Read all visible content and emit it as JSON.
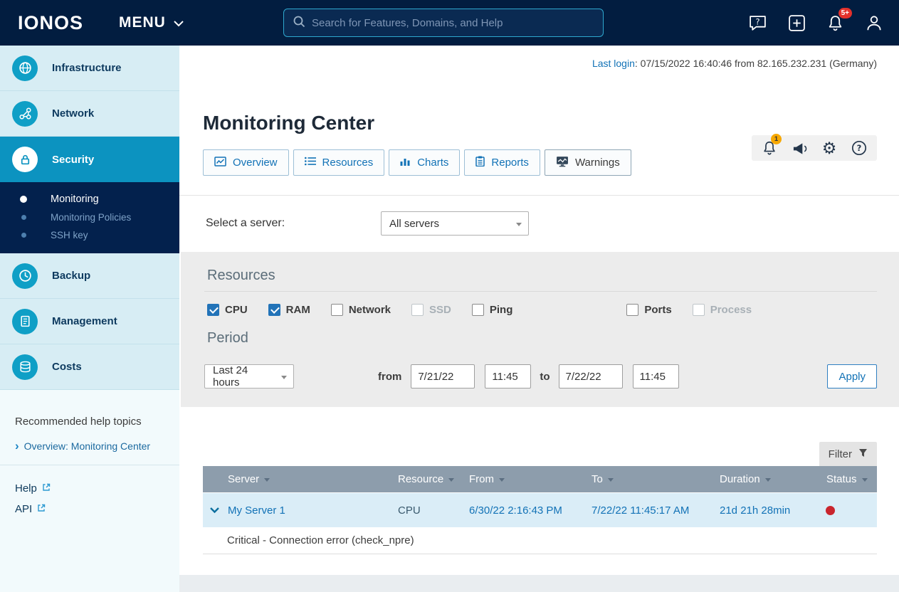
{
  "topbar": {
    "logo": "IONOS",
    "menu_label": "MENU",
    "search_placeholder": "Search for Features, Domains, and Help",
    "notifications_badge": "5+"
  },
  "sidebar": {
    "items": [
      {
        "label": "Infrastructure"
      },
      {
        "label": "Network"
      },
      {
        "label": "Security"
      },
      {
        "label": "Backup"
      },
      {
        "label": "Management"
      },
      {
        "label": "Costs"
      }
    ],
    "submenu": [
      {
        "label": "Monitoring"
      },
      {
        "label": "Monitoring Policies"
      },
      {
        "label": "SSH key"
      }
    ],
    "help_section": {
      "title": "Recommended help topics",
      "link": "Overview: Monitoring Center"
    },
    "footer_links": {
      "help": "Help",
      "api": "API"
    }
  },
  "content": {
    "last_login": {
      "link": "Last login",
      "text": ": 07/15/2022 16:40:46 from 82.165.232.231 (Germany)"
    },
    "toolbar_badge": "1",
    "title": "Monitoring Center",
    "tabs": [
      {
        "label": "Overview"
      },
      {
        "label": "Resources"
      },
      {
        "label": "Charts"
      },
      {
        "label": "Reports"
      },
      {
        "label": "Warnings"
      }
    ],
    "server_select": {
      "label": "Select a server:",
      "value": "All servers"
    },
    "resources": {
      "title": "Resources",
      "options": [
        {
          "label": "CPU",
          "checked": true,
          "disabled": false
        },
        {
          "label": "RAM",
          "checked": true,
          "disabled": false
        },
        {
          "label": "Network",
          "checked": false,
          "disabled": false
        },
        {
          "label": "SSD",
          "checked": false,
          "disabled": true
        },
        {
          "label": "Ping",
          "checked": false,
          "disabled": false
        },
        {
          "label": "Ports",
          "checked": false,
          "disabled": false
        },
        {
          "label": "Process",
          "checked": false,
          "disabled": true
        }
      ]
    },
    "period": {
      "title": "Period",
      "preset": "Last 24 hours",
      "from_label": "from",
      "from_date": "7/21/22",
      "from_time": "11:45",
      "to_label": "to",
      "to_date": "7/22/22",
      "to_time": "11:45",
      "apply": "Apply"
    },
    "warnings_table": {
      "filter": "Filter",
      "columns": [
        "Server",
        "Resource",
        "From",
        "To",
        "Duration",
        "Status"
      ],
      "rows": [
        {
          "server": "My Server 1",
          "resource": "CPU",
          "from": "6/30/22 2:16:43 PM",
          "to": "7/22/22 11:45:17 AM",
          "duration": "21d 21h 28min",
          "status": "critical",
          "detail": "Critical - Connection error (check_npre)"
        }
      ]
    }
  },
  "colors": {
    "topbar_navy": "#021d40",
    "sidebar_teal": "#0f9fc6",
    "active_nav": "#0c93c0",
    "link_blue": "#1272b6",
    "table_header": "#8d9dac",
    "row_highlight": "#daedf7",
    "status_critical": "#c9252d",
    "badge_red": "#e4312b",
    "badge_yellow": "#f7a800"
  }
}
